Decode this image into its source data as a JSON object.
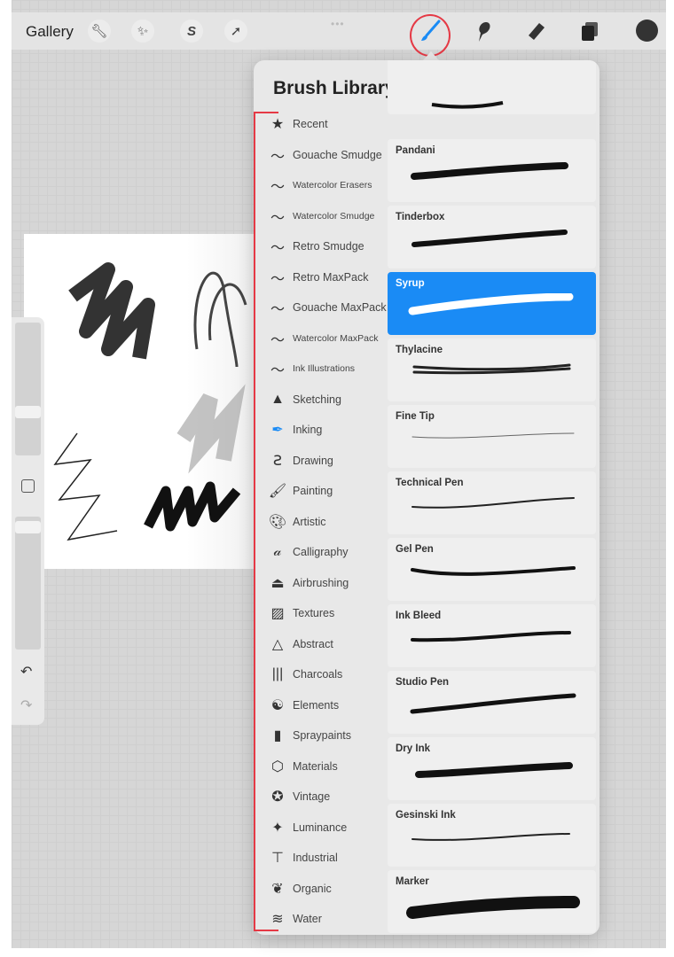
{
  "topbar": {
    "gallery_label": "Gallery",
    "left_tools": [
      "wrench-icon",
      "magic-wand-icon",
      "selection-icon",
      "transform-arrow-icon"
    ],
    "right_tools": [
      "brush-icon",
      "smudge-icon",
      "eraser-icon",
      "layers-icon",
      "color-icon"
    ],
    "active_tool": "brush-icon",
    "accent": "#1a8bf5",
    "current_color": "#333333"
  },
  "panel": {
    "title": "Brush Library",
    "add_label": "+"
  },
  "categories": [
    {
      "label": "Recent",
      "icon": "star"
    },
    {
      "label": "Gouache Smudge",
      "icon": "brush-stroke"
    },
    {
      "label": "Watercolor Erasers",
      "icon": "brush-stroke"
    },
    {
      "label": "Watercolor Smudge",
      "icon": "brush-stroke"
    },
    {
      "label": "Retro Smudge",
      "icon": "brush-stroke"
    },
    {
      "label": "Retro MaxPack",
      "icon": "brush-stroke"
    },
    {
      "label": "Gouache MaxPack",
      "icon": "brush-stroke"
    },
    {
      "label": "Watercolor MaxPack",
      "icon": "brush-stroke"
    },
    {
      "label": "Ink Illustrations",
      "icon": "brush-stroke"
    },
    {
      "label": "Sketching",
      "icon": "pencil-tip"
    },
    {
      "label": "Inking",
      "icon": "pen-nib"
    },
    {
      "label": "Drawing",
      "icon": "squiggle"
    },
    {
      "label": "Painting",
      "icon": "paintbrush"
    },
    {
      "label": "Artistic",
      "icon": "palette"
    },
    {
      "label": "Calligraphy",
      "icon": "script-a"
    },
    {
      "label": "Airbrushing",
      "icon": "airbrush"
    },
    {
      "label": "Textures",
      "icon": "hatch"
    },
    {
      "label": "Abstract",
      "icon": "triangle"
    },
    {
      "label": "Charcoals",
      "icon": "bars"
    },
    {
      "label": "Elements",
      "icon": "yin-yang"
    },
    {
      "label": "Spraypaints",
      "icon": "spray-can"
    },
    {
      "label": "Materials",
      "icon": "cube"
    },
    {
      "label": "Vintage",
      "icon": "star-circle"
    },
    {
      "label": "Luminance",
      "icon": "sparkle"
    },
    {
      "label": "Industrial",
      "icon": "anvil"
    },
    {
      "label": "Organic",
      "icon": "leaf"
    },
    {
      "label": "Water",
      "icon": "waves"
    }
  ],
  "brushes": [
    {
      "name": "Pandani"
    },
    {
      "name": "Tinderbox"
    },
    {
      "name": "Syrup",
      "selected": true
    },
    {
      "name": "Thylacine"
    },
    {
      "name": "Fine Tip"
    },
    {
      "name": "Technical Pen"
    },
    {
      "name": "Gel Pen"
    },
    {
      "name": "Ink Bleed"
    },
    {
      "name": "Studio Pen"
    },
    {
      "name": "Dry Ink"
    },
    {
      "name": "Gesinski Ink"
    },
    {
      "name": "Marker"
    }
  ],
  "sidebar": {
    "undo_icon": "undo-icon",
    "redo_icon": "redo-icon"
  }
}
